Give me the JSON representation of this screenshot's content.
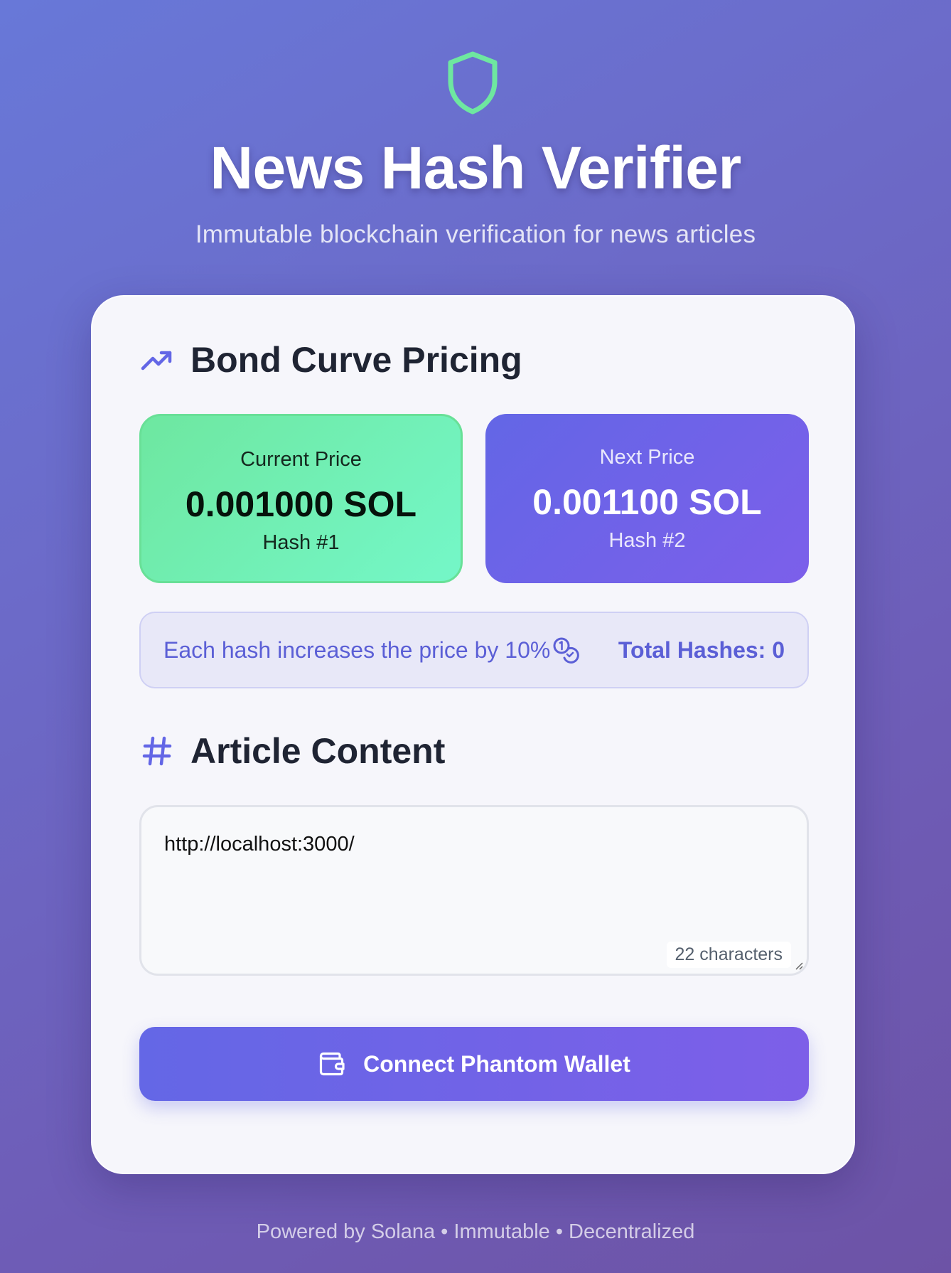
{
  "header": {
    "icon": "shield-icon",
    "title": "News Hash Verifier",
    "subtitle": "Immutable blockchain verification for news articles"
  },
  "pricing": {
    "icon": "trending-up-icon",
    "heading": "Bond Curve Pricing",
    "current": {
      "label": "Current Price",
      "value": "0.001000 SOL",
      "hash": "Hash #1"
    },
    "next": {
      "label": "Next Price",
      "value": "0.001100 SOL",
      "hash": "Hash #2"
    },
    "info_text": "Each hash increases the price by 10%",
    "info_icon": "coins-icon",
    "total_hashes": "Total Hashes: 0"
  },
  "article": {
    "icon": "hash-icon",
    "heading": "Article Content",
    "value": "http://localhost:3000/",
    "char_count": "22 characters"
  },
  "connect_button": {
    "icon": "wallet-icon",
    "label": "Connect Phantom Wallet"
  },
  "footer": {
    "text": "Powered by Solana • Immutable • Decentralized"
  },
  "colors": {
    "accent": "#6366e6",
    "accent_purple": "#7c5fea",
    "green": "#6ee7a0",
    "shield": "#6ee7a0"
  }
}
